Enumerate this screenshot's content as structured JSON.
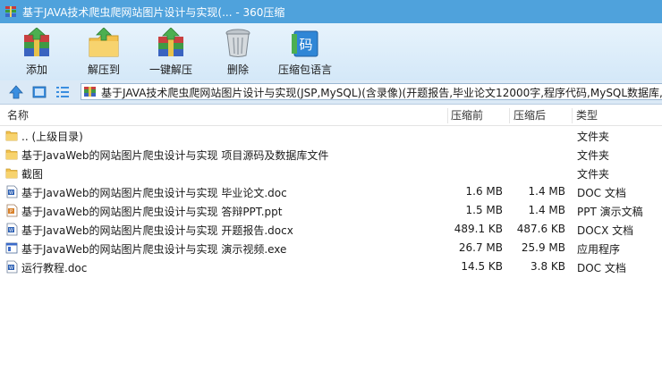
{
  "window": {
    "title": "基于JAVA技术爬虫爬网站图片设计与实现(... - 360压缩"
  },
  "toolbar": {
    "buttons": [
      {
        "label": "添加",
        "icon": "add-books-icon"
      },
      {
        "label": "解压到",
        "icon": "extract-to-folder-icon"
      },
      {
        "label": "一键解压",
        "icon": "one-click-extract-icon"
      },
      {
        "label": "删除",
        "icon": "trash-can-icon"
      },
      {
        "label": "压缩包语言",
        "icon": "archive-language-icon"
      }
    ],
    "language_glyph": "码"
  },
  "address": {
    "path": "基于JAVA技术爬虫爬网站图片设计与实现(JSP,MySQL)(含录像)(开题报告,毕业论文12000字,程序代码,MySQL数据库,答"
  },
  "columns": {
    "name": "名称",
    "compressed": "压缩前",
    "after": "压缩后",
    "type": "类型"
  },
  "files": [
    {
      "name": ".. (上级目录)",
      "before": "",
      "after": "",
      "type": "文件夹",
      "kind": "folder"
    },
    {
      "name": "基于JavaWeb的网站图片爬虫设计与实现 项目源码及数据库文件",
      "before": "",
      "after": "",
      "type": "文件夹",
      "kind": "folder"
    },
    {
      "name": "截图",
      "before": "",
      "after": "",
      "type": "文件夹",
      "kind": "folder"
    },
    {
      "name": "基于JavaWeb的网站图片爬虫设计与实现 毕业论文.doc",
      "before": "1.6 MB",
      "after": "1.4 MB",
      "type": "DOC 文档",
      "kind": "doc"
    },
    {
      "name": "基于JavaWeb的网站图片爬虫设计与实现 答辩PPT.ppt",
      "before": "1.5 MB",
      "after": "1.4 MB",
      "type": "PPT 演示文稿",
      "kind": "ppt"
    },
    {
      "name": "基于JavaWeb的网站图片爬虫设计与实现 开题报告.docx",
      "before": "489.1 KB",
      "after": "487.6 KB",
      "type": "DOCX 文档",
      "kind": "doc"
    },
    {
      "name": "基于JavaWeb的网站图片爬虫设计与实现 演示视频.exe",
      "before": "26.7 MB",
      "after": "25.9 MB",
      "type": "应用程序",
      "kind": "exe"
    },
    {
      "name": "运行教程.doc",
      "before": "14.5 KB",
      "after": "3.8 KB",
      "type": "DOC 文档",
      "kind": "doc"
    }
  ],
  "colors": {
    "titlebar": "#4fa2dc",
    "folder": "#f2c14e",
    "doc": "#2b5fb4",
    "ppt": "#d9822b"
  }
}
